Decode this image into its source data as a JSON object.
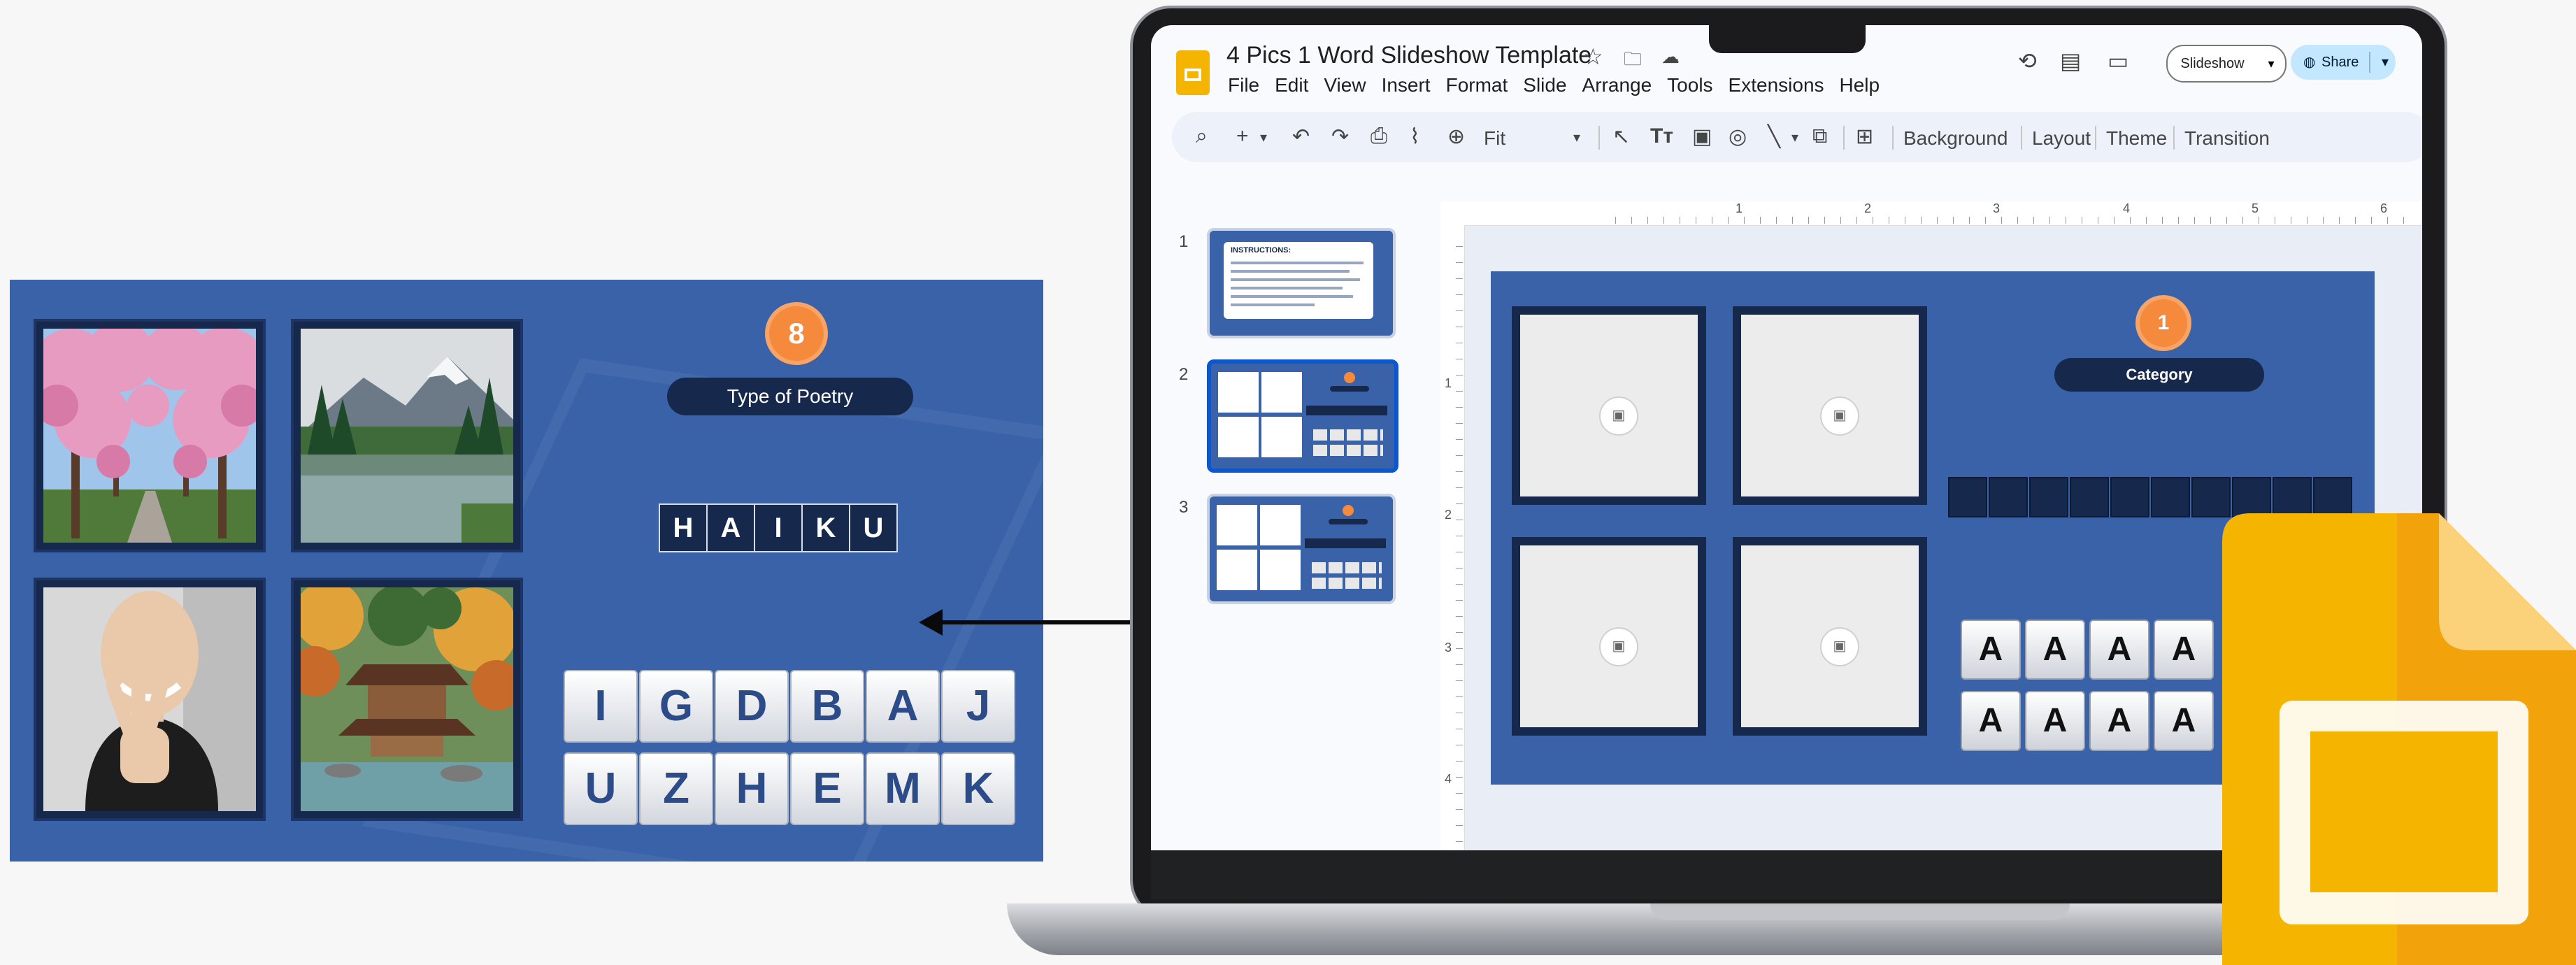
{
  "preview": {
    "badge": "8",
    "category": "Type of Poetry",
    "answer": [
      "H",
      "A",
      "I",
      "K",
      "U"
    ],
    "tiles_row1": [
      "I",
      "G",
      "D",
      "B",
      "A",
      "J"
    ],
    "tiles_row2": [
      "U",
      "Z",
      "H",
      "E",
      "M",
      "K"
    ]
  },
  "app": {
    "title": "4 Pics 1 Word Slideshow Template",
    "menu": [
      "File",
      "Edit",
      "View",
      "Insert",
      "Format",
      "Slide",
      "Arrange",
      "Tools",
      "Extensions",
      "Help"
    ],
    "slideshow_label": "Slideshow",
    "share_label": "Share",
    "zoom": "Fit",
    "toolbar_text": [
      "Background",
      "Layout",
      "Theme",
      "Transition"
    ],
    "thumbnails": [
      {
        "num": "1",
        "heading": "INSTRUCTIONS:"
      },
      {
        "num": "2"
      },
      {
        "num": "3"
      }
    ],
    "ruler_h": [
      "1",
      "2",
      "3",
      "4",
      "5",
      "6"
    ],
    "ruler_v": [
      "1",
      "2",
      "3",
      "4"
    ]
  },
  "main_slide": {
    "badge": "1",
    "category": "Category",
    "tile_letter": "A"
  },
  "colors": {
    "slide_blue": "#3962a8",
    "navy": "#16294d",
    "badge_orange": "#f58a3c",
    "slides_yellow": "#f4b400",
    "share_blue": "#c2e7ff"
  }
}
